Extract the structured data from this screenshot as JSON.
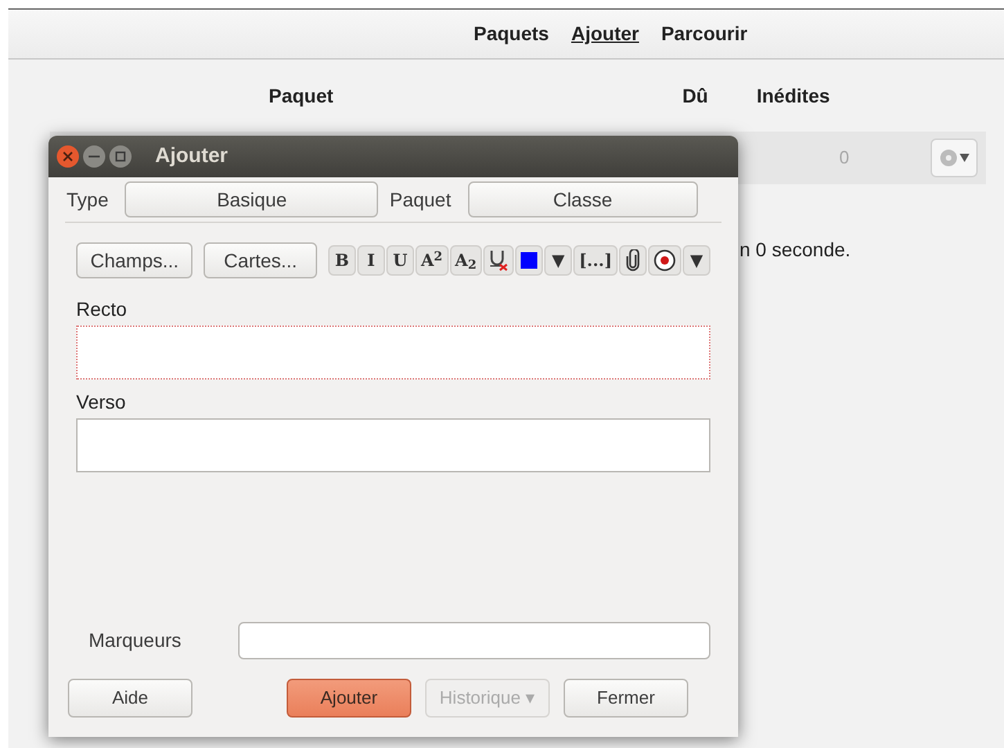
{
  "main_window": {
    "toolbar": [
      {
        "label": "Paquets",
        "selected": false
      },
      {
        "label": "Ajouter",
        "selected": true
      },
      {
        "label": "Parcourir",
        "selected": false
      }
    ],
    "columns": [
      "Paquet",
      "Dû",
      "Inédites"
    ],
    "row": {
      "column_3": "0"
    },
    "status_text": "n 0 seconde."
  },
  "dialog": {
    "title": "Ajouter",
    "type_label": "Type",
    "type_value": "Basique",
    "deck_label": "Paquet",
    "deck_value": "Classe",
    "fields_button": "Champs...",
    "cards_button": "Cartes...",
    "format_buttons": [
      {
        "kind": "text",
        "label": "B"
      },
      {
        "kind": "text",
        "label": "I"
      },
      {
        "kind": "text",
        "label": "U"
      },
      {
        "kind": "text",
        "label": "A$^{2}$"
      },
      {
        "kind": "text",
        "label": "A$_{2}$"
      },
      {
        "kind": "clear"
      },
      {
        "kind": "color",
        "color": "#0000ff"
      },
      {
        "kind": "text",
        "label": "▼"
      },
      {
        "kind": "text",
        "label": "[...]"
      },
      {
        "kind": "attach"
      },
      {
        "kind": "record"
      },
      {
        "kind": "text",
        "label": "▼"
      }
    ],
    "note_fields": [
      {
        "label": "Recto",
        "focused": true
      },
      {
        "label": "Verso",
        "focused": false
      }
    ],
    "tags_label": "Marqueurs",
    "buttons": [
      {
        "label": "Aide",
        "kind": "normal"
      },
      {
        "label": "Ajouter",
        "kind": "default"
      },
      {
        "label": "Historique ▾",
        "kind": "disabled"
      },
      {
        "label": "Fermer",
        "kind": "normal"
      }
    ]
  }
}
